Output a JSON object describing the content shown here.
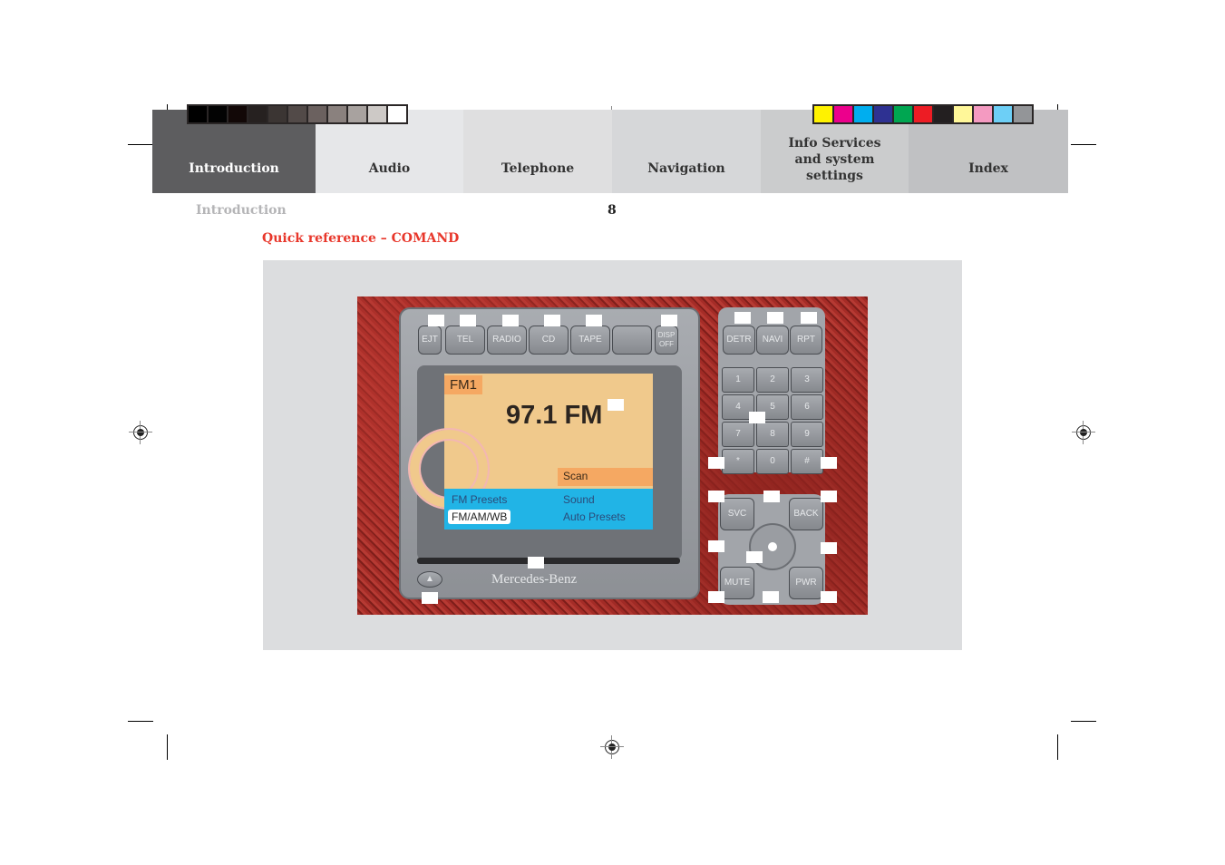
{
  "tabs": [
    {
      "label": "Introduction",
      "active": true
    },
    {
      "label": "Audio"
    },
    {
      "label": "Telephone"
    },
    {
      "label": "Navigation"
    },
    {
      "label": "Info Services and system settings"
    },
    {
      "label": "Index"
    }
  ],
  "header": {
    "section": "Introduction",
    "page_number": "8"
  },
  "title": "Quick reference – COMAND",
  "colors": {
    "grayscale": [
      "#000000",
      "#030303",
      "#120807",
      "#262120",
      "#3b3533",
      "#524a48",
      "#6b615f",
      "#8a817e",
      "#a8a29f",
      "#cdc9c6",
      "#ffffff"
    ],
    "process": [
      "#fff200",
      "#ec008c",
      "#00aeef",
      "#2e3192",
      "#00a651",
      "#ed1c24",
      "#231f20",
      "#fff799",
      "#f49ac1",
      "#6dcff6",
      "#939598"
    ],
    "accent": "#e8372b"
  },
  "device": {
    "top_buttons": [
      "EJT",
      "TEL",
      "RADIO",
      "CD",
      "TAPE",
      "",
      "DISP OFF"
    ],
    "side_buttons": [
      "DETR",
      "NAVI",
      "RPT"
    ],
    "keypad": [
      "1",
      "2",
      "3",
      "4",
      "5",
      "6",
      "7",
      "8",
      "9",
      "*",
      "0",
      "#"
    ],
    "control_buttons": [
      "SVC",
      "BACK",
      "MUTE",
      "PWR"
    ],
    "screen": {
      "band": "FM1",
      "frequency": "97.1 FM",
      "scan": "Scan",
      "menu_left": [
        "FM Presets",
        "FM/AM/WB"
      ],
      "menu_right": [
        "Sound",
        "Auto Presets"
      ]
    },
    "brand": "Mercedes-Benz"
  }
}
